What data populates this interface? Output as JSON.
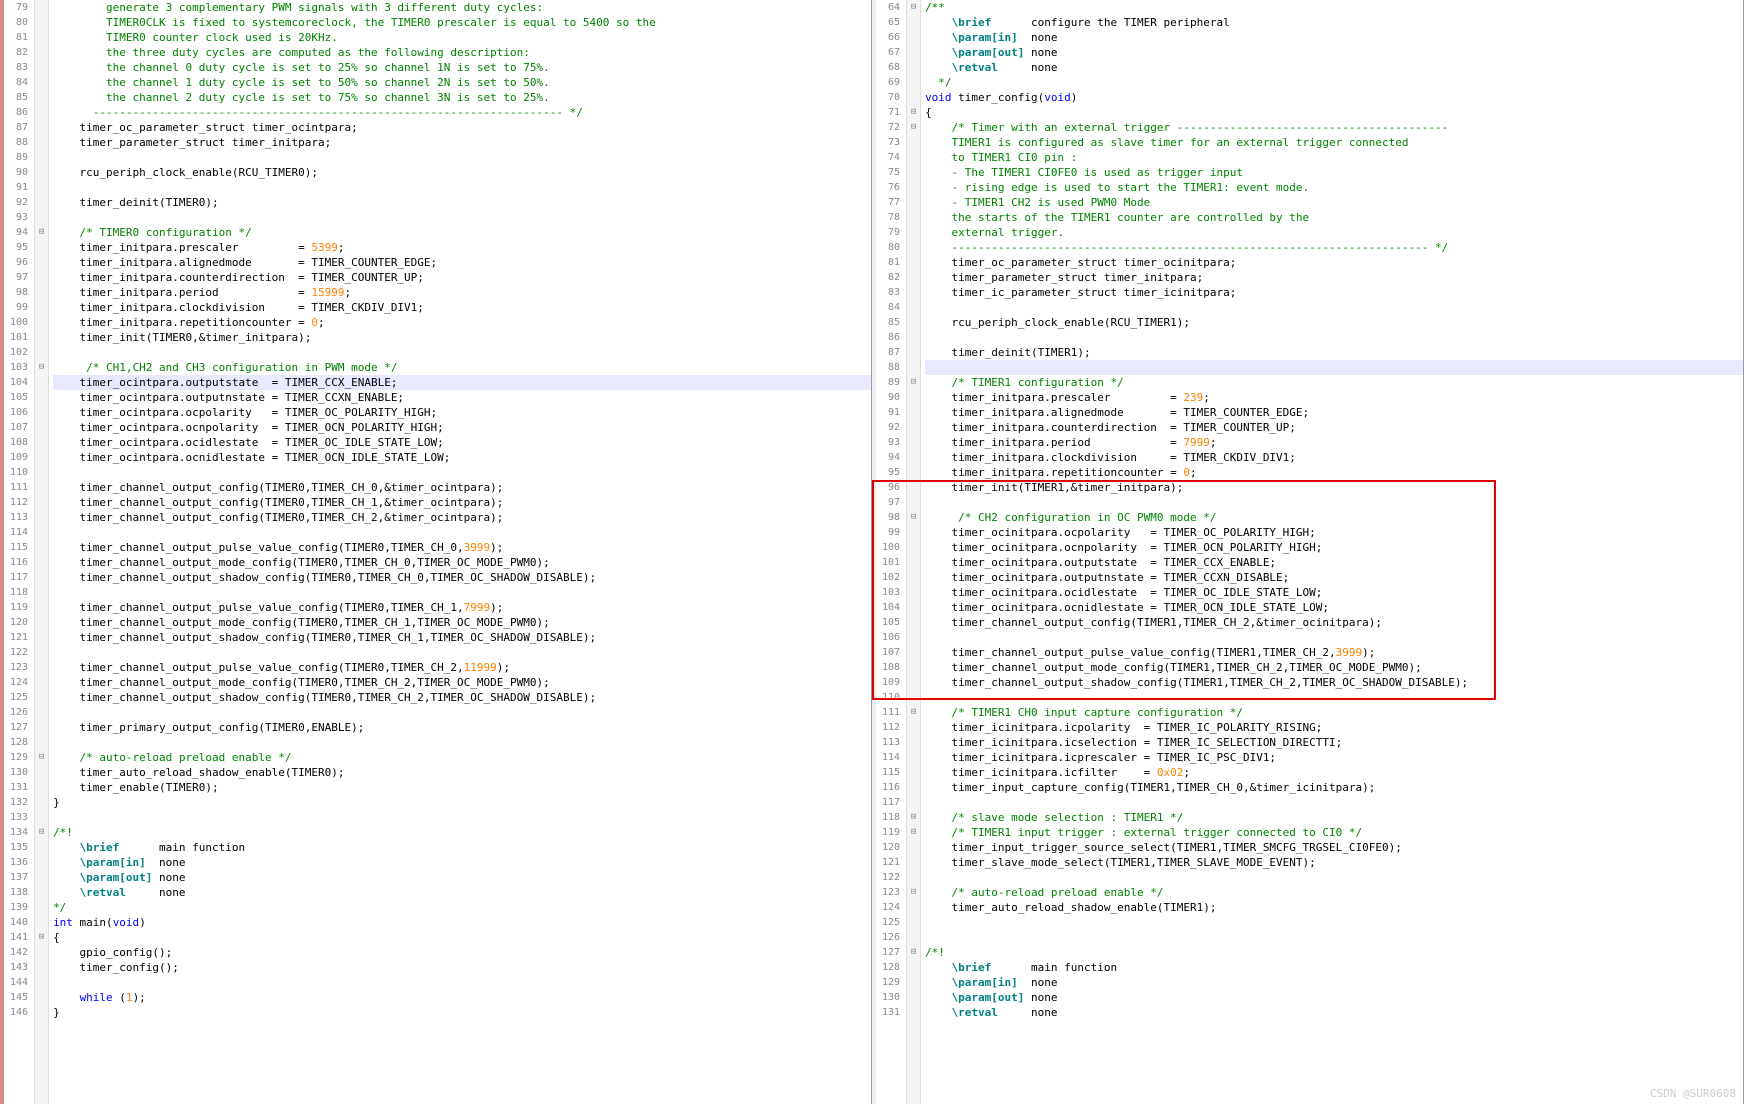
{
  "watermark": "CSDN @SUR0608",
  "left": {
    "startLine": 79,
    "lines": [
      {
        "cls": "cm",
        "t": "        generate 3 complementary PWM signals with 3 different duty cycles:"
      },
      {
        "cls": "cm",
        "t": "        TIMER0CLK is fixed to systemcoreclock, the TIMER0 prescaler is equal to 5400 so the"
      },
      {
        "cls": "cm",
        "t": "        TIMER0 counter clock used is 20KHz."
      },
      {
        "cls": "cm",
        "t": "        the three duty cycles are computed as the following description:"
      },
      {
        "cls": "cm",
        "t": "        the channel 0 duty cycle is set to 25% so channel 1N is set to 75%."
      },
      {
        "cls": "cm",
        "t": "        the channel 1 duty cycle is set to 50% so channel 2N is set to 50%."
      },
      {
        "cls": "cm",
        "t": "        the channel 2 duty cycle is set to 75% so channel 3N is set to 25%."
      },
      {
        "cls": "cm",
        "t": "      ----------------------------------------------------------------------- */"
      },
      {
        "t": "    timer_oc_parameter_struct timer_ocintpara;"
      },
      {
        "t": "    timer_parameter_struct timer_initpara;"
      },
      {
        "t": ""
      },
      {
        "t": "    rcu_periph_clock_enable(RCU_TIMER0);"
      },
      {
        "t": ""
      },
      {
        "t": "    timer_deinit(TIMER0);"
      },
      {
        "t": ""
      },
      {
        "cls": "cm",
        "t": "    /* TIMER0 configuration */"
      },
      {
        "html": "    timer_initpara.prescaler         = <span class='num'>5399</span>;"
      },
      {
        "t": "    timer_initpara.alignedmode       = TIMER_COUNTER_EDGE;"
      },
      {
        "t": "    timer_initpara.counterdirection  = TIMER_COUNTER_UP;"
      },
      {
        "html": "    timer_initpara.period            = <span class='num'>15999</span>;"
      },
      {
        "t": "    timer_initpara.clockdivision     = TIMER_CKDIV_DIV1;"
      },
      {
        "html": "    timer_initpara.repetitioncounter = <span class='num'>0</span>;"
      },
      {
        "t": "    timer_init(TIMER0,&timer_initpara);"
      },
      {
        "t": ""
      },
      {
        "cls": "cm",
        "t": "     /* CH1,CH2 and CH3 configuration in PWM mode */"
      },
      {
        "hl": true,
        "t": "    timer_ocintpara.outputstate  = TIMER_CCX_ENABLE;"
      },
      {
        "t": "    timer_ocintpara.outputnstate = TIMER_CCXN_ENABLE;"
      },
      {
        "t": "    timer_ocintpara.ocpolarity   = TIMER_OC_POLARITY_HIGH;"
      },
      {
        "t": "    timer_ocintpara.ocnpolarity  = TIMER_OCN_POLARITY_HIGH;"
      },
      {
        "t": "    timer_ocintpara.ocidlestate  = TIMER_OC_IDLE_STATE_LOW;"
      },
      {
        "t": "    timer_ocintpara.ocnidlestate = TIMER_OCN_IDLE_STATE_LOW;"
      },
      {
        "t": ""
      },
      {
        "t": "    timer_channel_output_config(TIMER0,TIMER_CH_0,&timer_ocintpara);"
      },
      {
        "t": "    timer_channel_output_config(TIMER0,TIMER_CH_1,&timer_ocintpara);"
      },
      {
        "t": "    timer_channel_output_config(TIMER0,TIMER_CH_2,&timer_ocintpara);"
      },
      {
        "t": ""
      },
      {
        "html": "    timer_channel_output_pulse_value_config(TIMER0,TIMER_CH_0,<span class='num'>3999</span>);"
      },
      {
        "t": "    timer_channel_output_mode_config(TIMER0,TIMER_CH_0,TIMER_OC_MODE_PWM0);"
      },
      {
        "t": "    timer_channel_output_shadow_config(TIMER0,TIMER_CH_0,TIMER_OC_SHADOW_DISABLE);"
      },
      {
        "t": ""
      },
      {
        "html": "    timer_channel_output_pulse_value_config(TIMER0,TIMER_CH_1,<span class='num'>7999</span>);"
      },
      {
        "t": "    timer_channel_output_mode_config(TIMER0,TIMER_CH_1,TIMER_OC_MODE_PWM0);"
      },
      {
        "t": "    timer_channel_output_shadow_config(TIMER0,TIMER_CH_1,TIMER_OC_SHADOW_DISABLE);"
      },
      {
        "t": ""
      },
      {
        "html": "    timer_channel_output_pulse_value_config(TIMER0,TIMER_CH_2,<span class='num'>11999</span>);"
      },
      {
        "t": "    timer_channel_output_mode_config(TIMER0,TIMER_CH_2,TIMER_OC_MODE_PWM0);"
      },
      {
        "t": "    timer_channel_output_shadow_config(TIMER0,TIMER_CH_2,TIMER_OC_SHADOW_DISABLE);"
      },
      {
        "t": ""
      },
      {
        "t": "    timer_primary_output_config(TIMER0,ENABLE);"
      },
      {
        "t": ""
      },
      {
        "cls": "cm",
        "t": "    /* auto-reload preload enable */"
      },
      {
        "t": "    timer_auto_reload_shadow_enable(TIMER0);"
      },
      {
        "t": "    timer_enable(TIMER0);"
      },
      {
        "t": "}"
      },
      {
        "t": ""
      },
      {
        "cls": "cm",
        "t": "/*!"
      },
      {
        "html": "    <span class='doc'>\\brief</span>      main function"
      },
      {
        "html": "    <span class='doc'>\\param[in]</span>  none"
      },
      {
        "html": "    <span class='doc'>\\param[out]</span> none"
      },
      {
        "html": "    <span class='doc'>\\retval</span>     none"
      },
      {
        "cls": "cm",
        "t": "*/"
      },
      {
        "html": "<span class='kw'>int</span> main(<span class='kw'>void</span>)"
      },
      {
        "t": "{"
      },
      {
        "t": "    gpio_config();"
      },
      {
        "t": "    timer_config();"
      },
      {
        "t": ""
      },
      {
        "html": "    <span class='kw'>while</span> (<span class='num'>1</span>);"
      },
      {
        "t": "}"
      }
    ]
  },
  "right": {
    "startLine": 64,
    "lines": [
      {
        "cls": "cm",
        "t": "/**"
      },
      {
        "html": "    <span class='doc'>\\brief</span>      configure the TIMER peripheral"
      },
      {
        "html": "    <span class='doc'>\\param[in]</span>  none"
      },
      {
        "html": "    <span class='doc'>\\param[out]</span> none"
      },
      {
        "html": "    <span class='doc'>\\retval</span>     none"
      },
      {
        "cls": "cm",
        "t": "  */"
      },
      {
        "html": "<span class='kw'>void</span> timer_config(<span class='kw'>void</span>)"
      },
      {
        "t": "{"
      },
      {
        "cls": "cm",
        "t": "    /* Timer with an external trigger -----------------------------------------"
      },
      {
        "cls": "cm",
        "t": "    TIMER1 is configured as slave timer for an external trigger connected"
      },
      {
        "cls": "cm",
        "t": "    to TIMER1 CI0 pin :"
      },
      {
        "cls": "cm",
        "t": "    - The TIMER1 CI0FE0 is used as trigger input"
      },
      {
        "cls": "cm",
        "t": "    - rising edge is used to start the TIMER1: event mode."
      },
      {
        "cls": "cm",
        "t": "    - TIMER1 CH2 is used PWM0 Mode"
      },
      {
        "cls": "cm",
        "t": "    the starts of the TIMER1 counter are controlled by the"
      },
      {
        "cls": "cm",
        "t": "    external trigger."
      },
      {
        "cls": "cm",
        "t": "    ------------------------------------------------------------------------ */"
      },
      {
        "t": "    timer_oc_parameter_struct timer_ocinitpara;"
      },
      {
        "t": "    timer_parameter_struct timer_initpara;"
      },
      {
        "t": "    timer_ic_parameter_struct timer_icinitpara;"
      },
      {
        "t": ""
      },
      {
        "t": "    rcu_periph_clock_enable(RCU_TIMER1);"
      },
      {
        "t": ""
      },
      {
        "t": "    timer_deinit(TIMER1);"
      },
      {
        "hl": true,
        "t": ""
      },
      {
        "cls": "cm",
        "t": "    /* TIMER1 configuration */"
      },
      {
        "html": "    timer_initpara.prescaler         = <span class='num'>239</span>;"
      },
      {
        "t": "    timer_initpara.alignedmode       = TIMER_COUNTER_EDGE;"
      },
      {
        "t": "    timer_initpara.counterdirection  = TIMER_COUNTER_UP;"
      },
      {
        "html": "    timer_initpara.period            = <span class='num'>7999</span>;"
      },
      {
        "t": "    timer_initpara.clockdivision     = TIMER_CKDIV_DIV1;"
      },
      {
        "html": "    timer_initpara.repetitioncounter = <span class='num'>0</span>;"
      },
      {
        "t": "    timer_init(TIMER1,&timer_initpara);"
      },
      {
        "t": ""
      },
      {
        "cls": "cm",
        "t": "     /* CH2 configuration in OC PWM0 mode */"
      },
      {
        "t": "    timer_ocinitpara.ocpolarity   = TIMER_OC_POLARITY_HIGH;"
      },
      {
        "t": "    timer_ocinitpara.ocnpolarity  = TIMER_OCN_POLARITY_HIGH;"
      },
      {
        "t": "    timer_ocinitpara.outputstate  = TIMER_CCX_ENABLE;"
      },
      {
        "t": "    timer_ocinitpara.outputnstate = TIMER_CCXN_DISABLE;"
      },
      {
        "t": "    timer_ocinitpara.ocidlestate  = TIMER_OC_IDLE_STATE_LOW;"
      },
      {
        "t": "    timer_ocinitpara.ocnidlestate = TIMER_OCN_IDLE_STATE_LOW;"
      },
      {
        "t": "    timer_channel_output_config(TIMER1,TIMER_CH_2,&timer_ocinitpara);"
      },
      {
        "t": ""
      },
      {
        "html": "    timer_channel_output_pulse_value_config(TIMER1,TIMER_CH_2,<span class='num'>3999</span>);"
      },
      {
        "t": "    timer_channel_output_mode_config(TIMER1,TIMER_CH_2,TIMER_OC_MODE_PWM0);"
      },
      {
        "t": "    timer_channel_output_shadow_config(TIMER1,TIMER_CH_2,TIMER_OC_SHADOW_DISABLE);"
      },
      {
        "t": ""
      },
      {
        "cls": "cm",
        "t": "    /* TIMER1 CH0 input capture configuration */"
      },
      {
        "t": "    timer_icinitpara.icpolarity  = TIMER_IC_POLARITY_RISING;"
      },
      {
        "t": "    timer_icinitpara.icselection = TIMER_IC_SELECTION_DIRECTTI;"
      },
      {
        "t": "    timer_icinitpara.icprescaler = TIMER_IC_PSC_DIV1;"
      },
      {
        "html": "    timer_icinitpara.icfilter    = <span class='num'>0x02</span>;"
      },
      {
        "t": "    timer_input_capture_config(TIMER1,TIMER_CH_0,&timer_icinitpara);"
      },
      {
        "t": ""
      },
      {
        "cls": "cm",
        "t": "    /* slave mode selection : TIMER1 */"
      },
      {
        "cls": "cm",
        "t": "    /* TIMER1 input trigger : external trigger connected to CI0 */"
      },
      {
        "t": "    timer_input_trigger_source_select(TIMER1,TIMER_SMCFG_TRGSEL_CI0FE0);"
      },
      {
        "t": "    timer_slave_mode_select(TIMER1,TIMER_SLAVE_MODE_EVENT);"
      },
      {
        "t": ""
      },
      {
        "cls": "cm",
        "t": "    /* auto-reload preload enable */"
      },
      {
        "t": "    timer_auto_reload_shadow_enable(TIMER1);"
      },
      {
        "t": ""
      },
      {
        "t": ""
      },
      {
        "cls": "cm",
        "t": "/*!"
      },
      {
        "html": "    <span class='doc'>\\brief</span>      main function"
      },
      {
        "html": "    <span class='doc'>\\param[in]</span>  none"
      },
      {
        "html": "    <span class='doc'>\\param[out]</span> none"
      },
      {
        "html": "    <span class='doc'>\\retval</span>     none"
      }
    ]
  }
}
